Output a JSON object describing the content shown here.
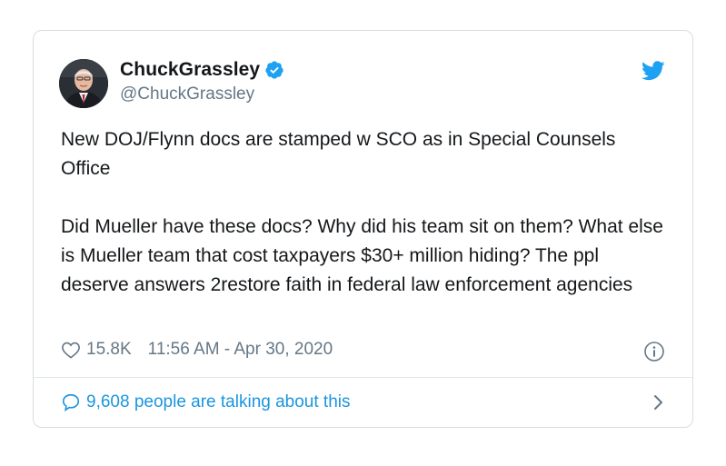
{
  "tweet": {
    "display_name": "ChuckGrassley",
    "handle": "@ChuckGrassley",
    "verified": true,
    "paragraphs": [
      "New DOJ/Flynn docs are stamped w SCO as in Special Counsels Office",
      "Did Mueller have these docs? Why did his team sit on them? What else is Mueller team that cost taxpayers $30+ million hiding? The ppl deserve answers 2restore faith in federal law enforcement agencies"
    ],
    "likes": "15.8K",
    "timestamp": "11:56 AM - Apr 30, 2020",
    "talking": "9,608 people are talking about this"
  },
  "icons": {
    "brand": "twitter-bird-icon",
    "verified": "verified-badge-icon",
    "like": "heart-icon",
    "info": "info-icon",
    "reply": "speech-bubble-icon",
    "more": "chevron-right-icon"
  },
  "colors": {
    "brand_blue": "#1da1f2",
    "link_blue": "#1b95e0",
    "text_primary": "#14171a",
    "text_secondary": "#657786",
    "border": "#d9dde1"
  }
}
